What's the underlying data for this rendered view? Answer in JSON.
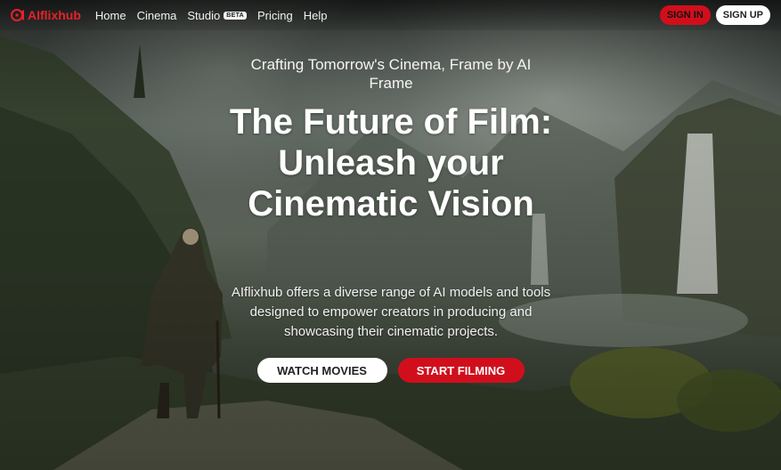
{
  "brand": {
    "name": "AIflixhub",
    "color": "#e8202a"
  },
  "nav": {
    "links": [
      {
        "label": "Home"
      },
      {
        "label": "Cinema"
      },
      {
        "label": "Studio",
        "badge": "BETA"
      },
      {
        "label": "Pricing"
      },
      {
        "label": "Help"
      }
    ],
    "sign_in": "SIGN IN",
    "sign_up": "SIGN UP"
  },
  "hero": {
    "tagline": "Crafting Tomorrow's Cinema, Frame by AI Frame",
    "headline": "The Future of Film: Unleash your Cinematic Vision",
    "description": "AIflixhub offers a diverse range of AI models and tools designed to empower creators in producing and showcasing their cinematic projects.",
    "watch_button": "WATCH MOVIES",
    "start_button": "START FILMING"
  },
  "colors": {
    "accent_red": "#d10f1c",
    "button_white": "#ffffff"
  },
  "icons": {
    "logo": "film-reel-logo-icon"
  }
}
